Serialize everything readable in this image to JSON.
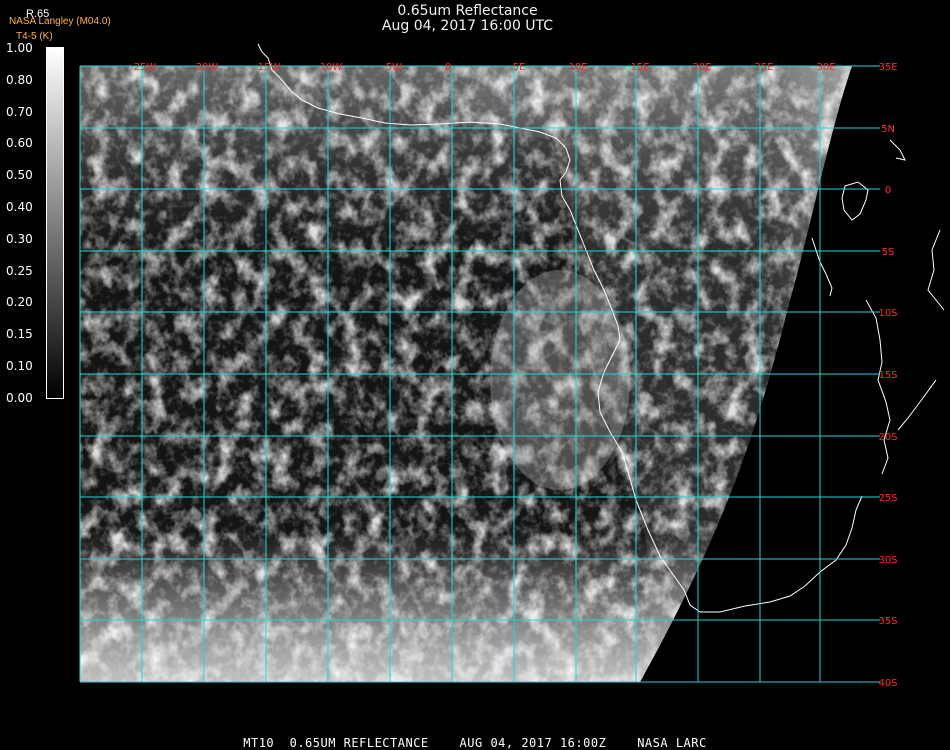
{
  "header": {
    "title": "0.65um Reflectance",
    "subtitle": "Aug 04, 2017 16:00 UTC",
    "producer": "NASA Langley (M04.0)",
    "producer_code": "T4-5 (K)"
  },
  "legend": {
    "variable": "R.65",
    "ticks": [
      "1.00",
      "0.80",
      "0.70",
      "0.60",
      "0.50",
      "0.40",
      "0.30",
      "0.25",
      "0.20",
      "0.15",
      "0.10",
      "0.00"
    ],
    "colormap": "grayscale white-to-black"
  },
  "map": {
    "longitude_labels": [
      "25W",
      "20W",
      "15W",
      "10W",
      "5W",
      "0",
      "5E",
      "10E",
      "15E",
      "20E",
      "25E",
      "30E"
    ],
    "latitude_labels": [
      "35E",
      "5N",
      "0",
      "5S",
      "10S",
      "15S",
      "20S",
      "25S",
      "30S",
      "35S",
      "40S"
    ],
    "grid_color": "#22d6d6",
    "label_color": "#ff2a2a",
    "coastline_color": "#ffffff"
  },
  "footer": {
    "text": "MT10  0.65UM REFLECTANCE    AUG 04, 2017 16:00Z    NASA LARC"
  }
}
